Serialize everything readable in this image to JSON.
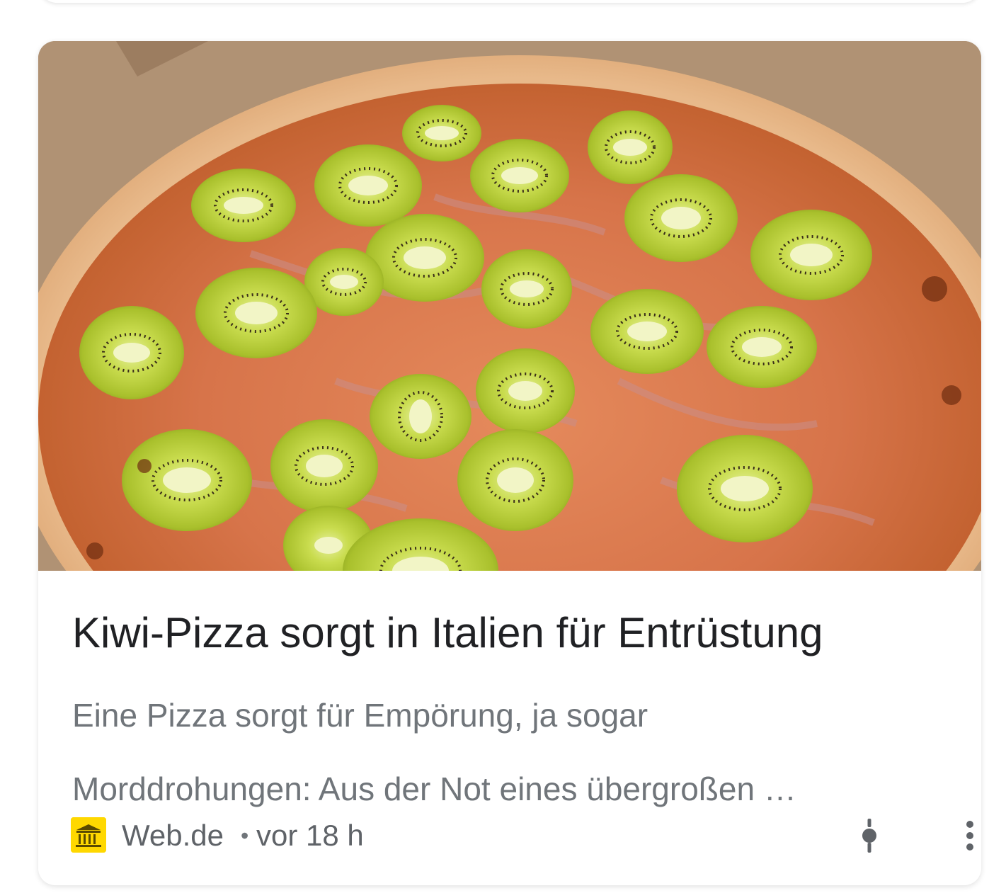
{
  "article": {
    "headline": "Kiwi-Pizza sorgt in Italien für Entrüstung",
    "snippet_line1": "Eine Pizza sorgt für Empörung, ja sogar",
    "snippet_line2": "Morddrohungen: Aus der Not eines übergroßen …",
    "image_alt": "Pizza mit Kiwischeiben",
    "source": {
      "name": "Web.de",
      "logo_icon": "bank-building-icon",
      "logo_color": "#ffd800"
    },
    "separator": "•",
    "time": "vor 18 h",
    "actions": {
      "follow_icon": "pin-icon",
      "more_icon": "more-vert-icon"
    }
  }
}
